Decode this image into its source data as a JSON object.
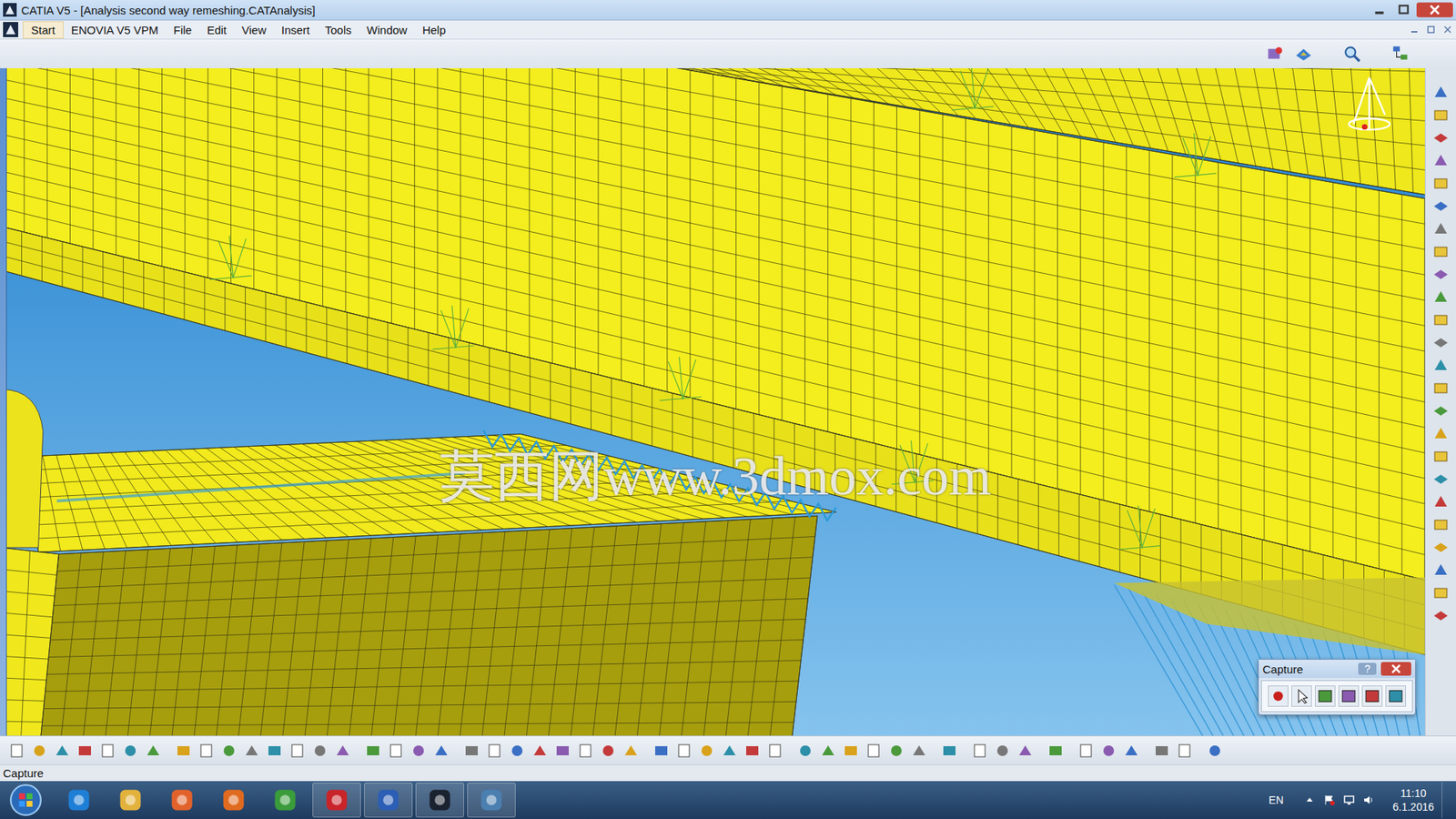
{
  "window": {
    "title": "CATIA V5 - [Analysis second way remeshing.CATAnalysis]"
  },
  "menu": [
    {
      "label": "Start",
      "selected": true
    },
    {
      "label": "ENOVIA V5 VPM",
      "selected": false
    },
    {
      "label": "File",
      "selected": false
    },
    {
      "label": "Edit",
      "selected": false
    },
    {
      "label": "View",
      "selected": false
    },
    {
      "label": "Insert",
      "selected": false
    },
    {
      "label": "Tools",
      "selected": false
    },
    {
      "label": "Window",
      "selected": false
    },
    {
      "label": "Help",
      "selected": false
    }
  ],
  "watermark": "莫西网www.3dmox.com",
  "capture_dialog": {
    "title": "Capture",
    "help": "?"
  },
  "status_bar": "Capture",
  "taskbar": {
    "language": "EN",
    "time": "11:10",
    "date": "6.1.2016"
  }
}
